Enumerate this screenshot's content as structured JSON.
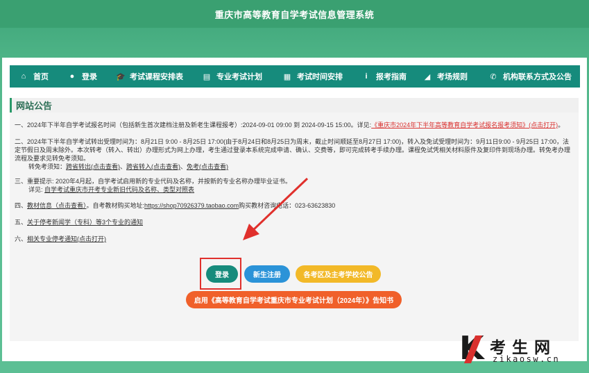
{
  "header": {
    "system_title": "重庆市高等教育自学考试信息管理系统"
  },
  "nav": [
    {
      "label": "首页",
      "icon": "home-icon",
      "glyph": "⌂"
    },
    {
      "label": "登录",
      "icon": "user-icon",
      "glyph": "●"
    },
    {
      "label": "考试课程安排表",
      "icon": "graduation-cap-icon",
      "glyph": "🎓"
    },
    {
      "label": "专业考试计划",
      "icon": "id-card-icon",
      "glyph": "▤"
    },
    {
      "label": "考试时间安排",
      "icon": "calendar-icon",
      "glyph": "▦"
    },
    {
      "label": "报考指南",
      "icon": "info-icon",
      "glyph": "i"
    },
    {
      "label": "考场规则",
      "icon": "bullhorn-icon",
      "glyph": "◢"
    },
    {
      "label": "机构联系方式及公告",
      "icon": "phone-icon",
      "glyph": "✆"
    }
  ],
  "announcements": {
    "title": "网站公告",
    "item1_text": "一、2024年下半年自学考试报名时间（包括新生首次建档注册及新老生课程报考）:2024-09-01 09:00  到  2024-09-15 15:00。详见:",
    "item1_link": "《重庆市2024年下半年高等教育自学考试报名报考须知》(点击打开)",
    "item1_end": "。",
    "item2_text": "二、2024年下半年自学考试转出受理时间为：8月21日 9:00 - 8月25日 17:00(由于8月24日和8月25日为周末，截止时间顺延至8月27日 17:00)，转入及免试受理时间为：9月11日9:00 - 9月25日 17:00，法定节假日及周末除外。本次转考（转入、转出）办理形式为网上办理，考生通过登录本系统完成申请、确认、交费等，即可完成转考手续办理。课程免试凭相关材料原件及复印件到现场办理。转免考办理流程及要求见转免考须知。",
    "item2_sub_label": "转免考须知：",
    "item2_link1": "跨省转出(点击查看)",
    "item2_link2": "跨省转入(点击查看)",
    "item2_link3": "免考(点击查看)",
    "item2_sep": "、",
    "item3_text": "三、重要提示: 2020年4月起，自学考试启用新的专业代码及名称，并按新的专业名称办理毕业证书。",
    "item3_sub_label": "详见: ",
    "item3_link": "自学考试重庆市开考专业新旧代码及名称、类型对照表",
    "item4_prefix": "四、",
    "item4_link": "教材信息（点击查看）",
    "item4_text": "。自考教材购买地址:",
    "item4_url": "https://shop70926379.taobao.com",
    "item4_phone": "购买教材咨询电话：023-63623830",
    "item5_prefix": "五、",
    "item5_link": "关于停考新闻学（专科）等3个专业的通知",
    "item6_prefix": "六、",
    "item6_link": "相关专业停考通知(点击打开)"
  },
  "buttons": {
    "login": "登录",
    "register": "新生注册",
    "bulletin": "各考区及主考学校公告",
    "plan_notice": "启用《高等教育自学考试重庆市专业考试计划（2024年）》告知书"
  },
  "watermark": {
    "brand": "考生网",
    "url": "zikaosw.cn",
    "k": "K"
  },
  "colors": {
    "nav_bg": "#168b7c",
    "login_btn": "#168b7c",
    "register_btn": "#2b93d8",
    "bulletin_btn": "#f2b928",
    "plan_btn": "#f0602a",
    "highlight": "#e0302c"
  }
}
